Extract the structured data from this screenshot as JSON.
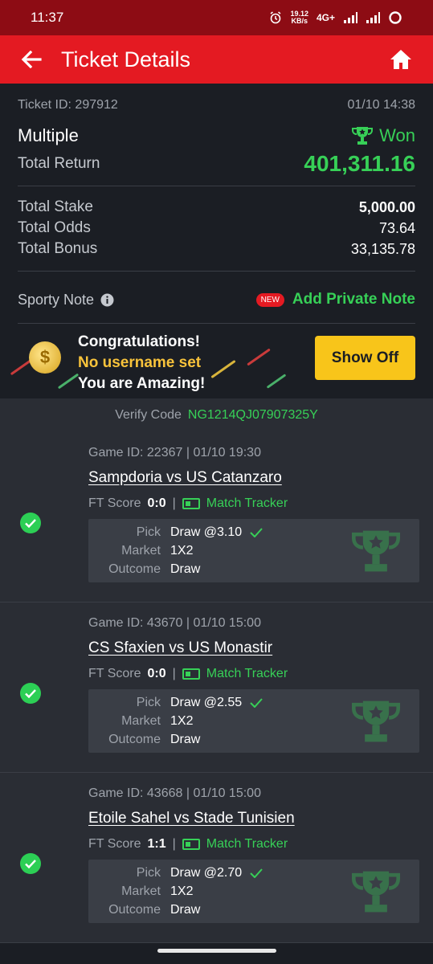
{
  "status_bar": {
    "time": "11:37",
    "speed_value": "19.12",
    "speed_unit": "KB/s",
    "network": "4G+"
  },
  "header": {
    "title": "Ticket Details"
  },
  "ticket": {
    "ticket_id": "Ticket ID: 297912",
    "date": "01/10 14:38",
    "type": "Multiple",
    "status": "Won",
    "total_return_label": "Total Return",
    "total_return": "401,311.16",
    "total_stake_label": "Total Stake",
    "total_stake": "5,000.00",
    "total_odds_label": "Total Odds",
    "total_odds": "73.64",
    "total_bonus_label": "Total Bonus",
    "total_bonus": "33,135.78"
  },
  "note": {
    "label": "Sporty Note",
    "new_badge": "NEW",
    "add_label": "Add Private Note"
  },
  "banner": {
    "line1": "Congratulations!",
    "line2": "No username set",
    "line3": "You are Amazing!",
    "button": "Show Off"
  },
  "verify": {
    "label": "Verify Code",
    "code": "NG1214QJ07907325Y"
  },
  "games": [
    {
      "id_line": "Game ID: 22367 | 01/10 19:30",
      "teams": "Sampdoria vs US Catanzaro",
      "score_label": "FT Score",
      "score": "0:0",
      "tracker": "Match Tracker",
      "pick_label": "Pick",
      "pick": "Draw @3.10",
      "market_label": "Market",
      "market": "1X2",
      "outcome_label": "Outcome",
      "outcome": "Draw"
    },
    {
      "id_line": "Game ID: 43670 | 01/10 15:00",
      "teams": "CS Sfaxien vs US Monastir",
      "score_label": "FT Score",
      "score": "0:0",
      "tracker": "Match Tracker",
      "pick_label": "Pick",
      "pick": "Draw @2.55",
      "market_label": "Market",
      "market": "1X2",
      "outcome_label": "Outcome",
      "outcome": "Draw"
    },
    {
      "id_line": "Game ID: 43668 | 01/10 15:00",
      "teams": "Etoile Sahel vs Stade Tunisien",
      "score_label": "FT Score",
      "score": "1:1",
      "tracker": "Match Tracker",
      "pick_label": "Pick",
      "pick": "Draw @2.70",
      "market_label": "Market",
      "market": "1X2",
      "outcome_label": "Outcome",
      "outcome": "Draw"
    }
  ],
  "colors": {
    "brand_red": "#e41a22",
    "status_dark_red": "#8d0c14",
    "win_green": "#37d057",
    "accent_yellow": "#f8c51a",
    "background": "#1b1e24",
    "card": "#2a2d34"
  }
}
